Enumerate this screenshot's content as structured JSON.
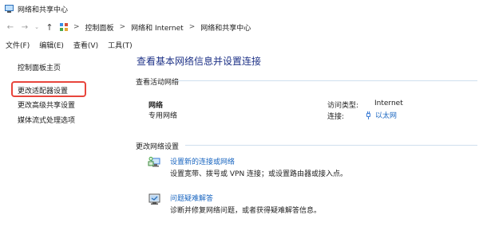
{
  "window": {
    "title": "网络和共享中心",
    "icon": "network-monitor-icon"
  },
  "address": {
    "back_icon": "arrow-left-icon",
    "forward_icon": "arrow-right-icon",
    "history_icon": "chevron-down-icon",
    "up_icon": "arrow-up-icon",
    "location_icon": "control-panel-icon",
    "separator": ">",
    "crumbs": [
      "控制面板",
      "网络和 Internet",
      "网络和共享中心"
    ]
  },
  "menu": {
    "items": [
      "文件(F)",
      "编辑(E)",
      "查看(V)",
      "工具(T)"
    ]
  },
  "sidebar": {
    "items": [
      "控制面板主页",
      "更改适配器设置",
      "更改高级共享设置",
      "媒体流式处理选项"
    ],
    "highlight_color": "#e8453c"
  },
  "main": {
    "title": "查看基本网络信息并设置连接",
    "active_section": {
      "label": "查看活动网络",
      "network_name": "网络",
      "network_category": "专用网络",
      "access_type_label": "访问类型:",
      "access_type_value": "Internet",
      "connections_label": "连接:",
      "connection_value": "以太网",
      "connection_icon": "ethernet-icon"
    },
    "change_section": {
      "label": "更改网络设置",
      "tasks": [
        {
          "icon": "new-connection-icon",
          "link": "设置新的连接或网络",
          "desc": "设置宽带、拨号或 VPN 连接；或设置路由器或接入点。"
        },
        {
          "icon": "troubleshoot-icon",
          "link": "问题疑难解答",
          "desc": "诊断并修复网络问题，或者获得疑难解答信息。"
        }
      ]
    },
    "link_color": "#1a66c0",
    "title_color": "#1e3287"
  }
}
